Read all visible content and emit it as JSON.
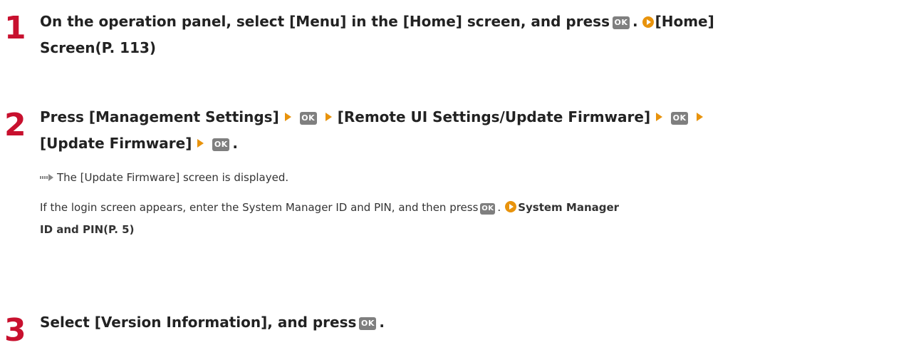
{
  "steps": [
    {
      "number": "1",
      "line1": "On the operation panel, select [Menu] in the [Home] screen, and press",
      "ok": "OK",
      "period": ".",
      "link_line1": "[Home]",
      "link_line2": "Screen(P. 113)"
    },
    {
      "number": "2",
      "part1": "Press [Management Settings]",
      "part2": "[Remote UI Settings/Update Firmware]",
      "part3": "[Update Firmware]",
      "ok": "OK",
      "period": ".",
      "result": "The [Update Firmware] screen is displayed.",
      "note": "If the login screen appears, enter the System Manager ID and PIN, and then press",
      "note_period": ".",
      "note_link_line1": "System Manager",
      "note_link_line2": "ID and PIN(P. 5)"
    },
    {
      "number": "3",
      "text": "Select [Version Information], and press",
      "ok": "OK",
      "period": "."
    }
  ],
  "colors": {
    "step_number": "#c8102e",
    "link_icon": "#e8930c",
    "ok_key": "#7f7f7f"
  }
}
